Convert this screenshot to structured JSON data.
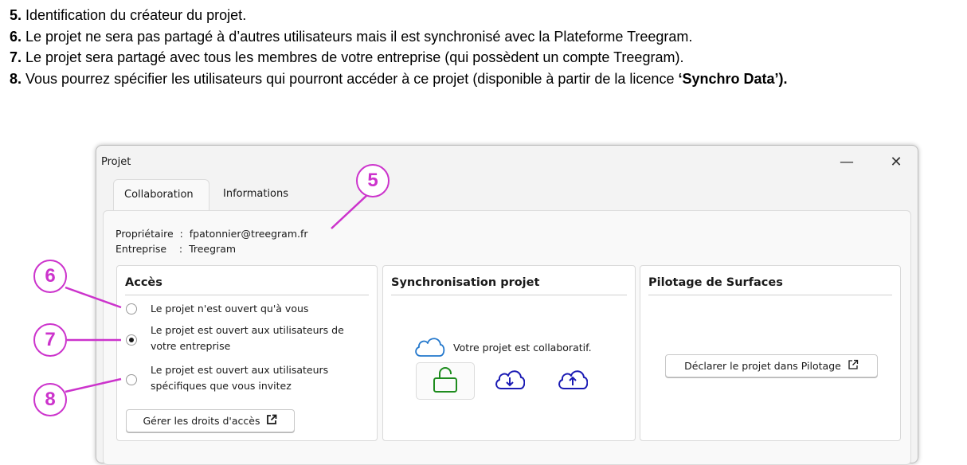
{
  "instructions": [
    {
      "num": "5.",
      "text": " Identification du créateur du projet.",
      "bold": ""
    },
    {
      "num": "6.",
      "text": " Le projet ne sera pas partagé à d’autres utilisateurs mais il est synchronisé avec la Plateforme Treegram.",
      "bold": ""
    },
    {
      "num": "7.",
      "text": " Le projet sera partagé avec tous les membres de votre entreprise (qui possèdent un compte Treegram).",
      "bold": ""
    },
    {
      "num": "8.",
      "text": " Vous pourrez spécifier les utilisateurs qui pourront accéder à ce projet (disponible à partir de la licence ",
      "bold": "‘Synchro Data’)."
    }
  ],
  "dialog": {
    "title": "Projet",
    "minimize_glyph": "—",
    "close_glyph": "✕",
    "tabs": {
      "collaboration": "Collaboration",
      "informations": "Informations"
    },
    "owner_line": "Propriétaire  :  fpatonnier@treegram.fr",
    "company_line": "Entreprise    :  Treegram"
  },
  "access": {
    "title": "Accès",
    "options": [
      {
        "label": "Le projet n'est ouvert qu'à vous",
        "selected": false
      },
      {
        "label": "Le projet est ouvert aux utilisateurs de votre entreprise",
        "selected": true
      },
      {
        "label": "Le projet est ouvert aux utilisateurs spécifiques que vous invitez",
        "selected": false
      }
    ],
    "manage_button": "Gérer les droits d'accès"
  },
  "sync": {
    "title": "Synchronisation projet",
    "status": "Votre projet est collaboratif.",
    "lock_color": "#1e8c1e",
    "arrow_color": "#1a1ab4",
    "cloud_color": "#2277cc"
  },
  "pilotage": {
    "title": "Pilotage de Surfaces",
    "button": "Déclarer le projet dans Pilotage"
  },
  "markers": {
    "m5": "5",
    "m6": "6",
    "m7": "7",
    "m8": "8",
    "color": "#cc33cc"
  },
  "icons": [
    "cloud-icon",
    "unlock-icon",
    "cloud-download-icon",
    "cloud-upload-icon",
    "external-link-icon"
  ]
}
